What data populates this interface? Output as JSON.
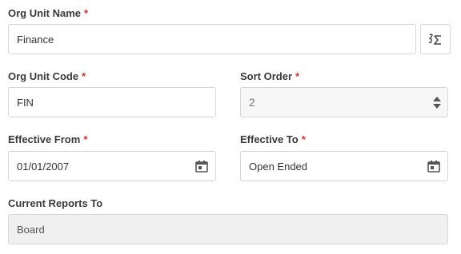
{
  "org_unit_name": {
    "label": "Org Unit Name",
    "required": "*",
    "value": "Finance"
  },
  "org_unit_code": {
    "label": "Org Unit Code",
    "required": "*",
    "value": "FIN"
  },
  "sort_order": {
    "label": "Sort Order",
    "required": "*",
    "value": "2"
  },
  "effective_from": {
    "label": "Effective From",
    "required": "*",
    "value": "01/01/2007"
  },
  "effective_to": {
    "label": "Effective To",
    "required": "*",
    "value": "Open Ended"
  },
  "current_reports_to": {
    "label": "Current Reports To",
    "value": "Board"
  },
  "icons": {
    "translate_button": "translate-sigma-icon",
    "calendar": "calendar-icon",
    "spinner_up": "spin-up-icon",
    "spinner_down": "spin-down-icon"
  },
  "colors": {
    "required": "#d9342b",
    "border": "#d6d6d6",
    "disabled_bg": "#f0f0f0"
  }
}
